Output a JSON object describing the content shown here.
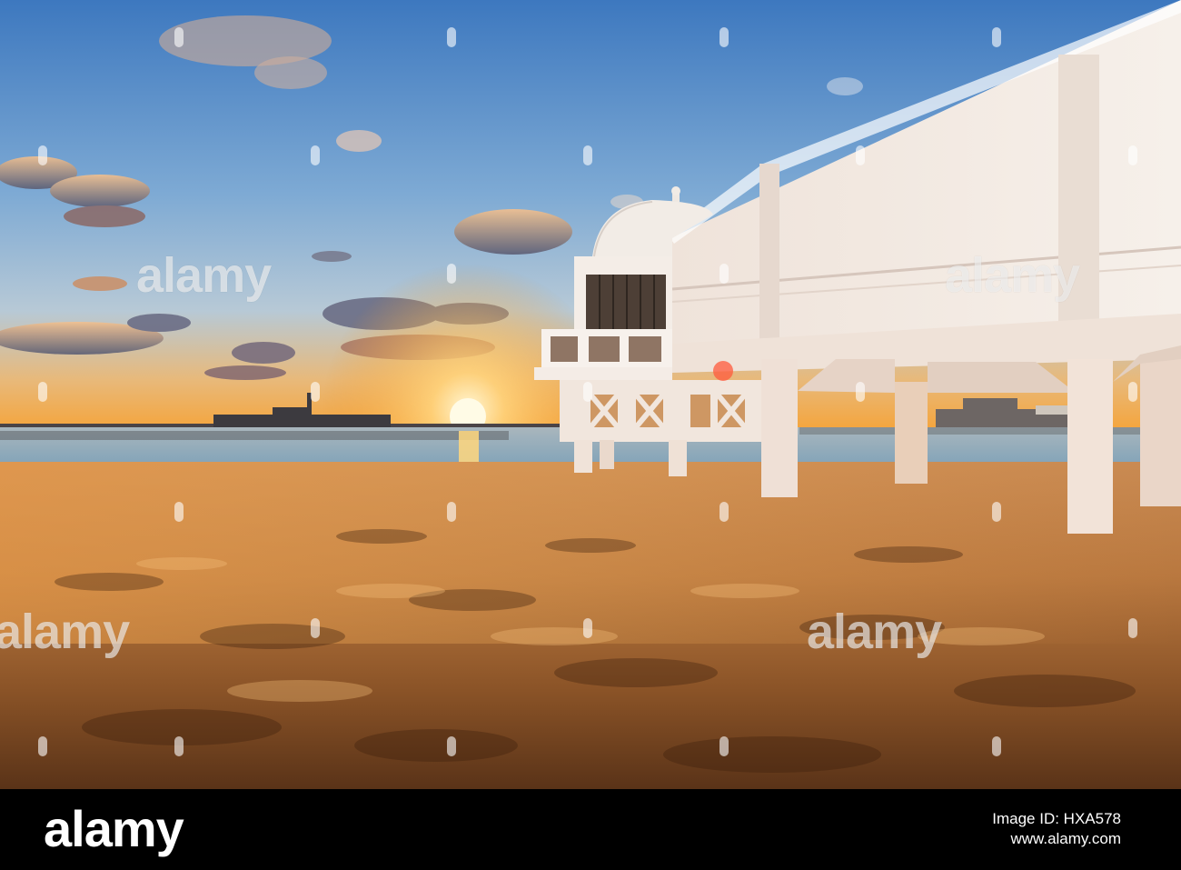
{
  "photo": {
    "scene": "sunset-beach-pavilion",
    "colors": {
      "sky_top": "#3f7bc2",
      "sky_mid": "#8fb6d8",
      "horizon": "#f6a23a",
      "sun": "#fff3c4",
      "sea": "#7fa2b8",
      "sand_light": "#e8a860",
      "sand_dark": "#4a2a14",
      "building": "#f3ece6",
      "building_shade": "#d9c9bf"
    }
  },
  "watermarks": {
    "text": "alamy",
    "left": "alamy",
    "right": "alamy",
    "bottom_left": "alamy",
    "bottom_right": "alamy"
  },
  "footer": {
    "brand": "alamy",
    "image_id_label": "Image ID: HXA578",
    "site": "www.alamy.com"
  }
}
